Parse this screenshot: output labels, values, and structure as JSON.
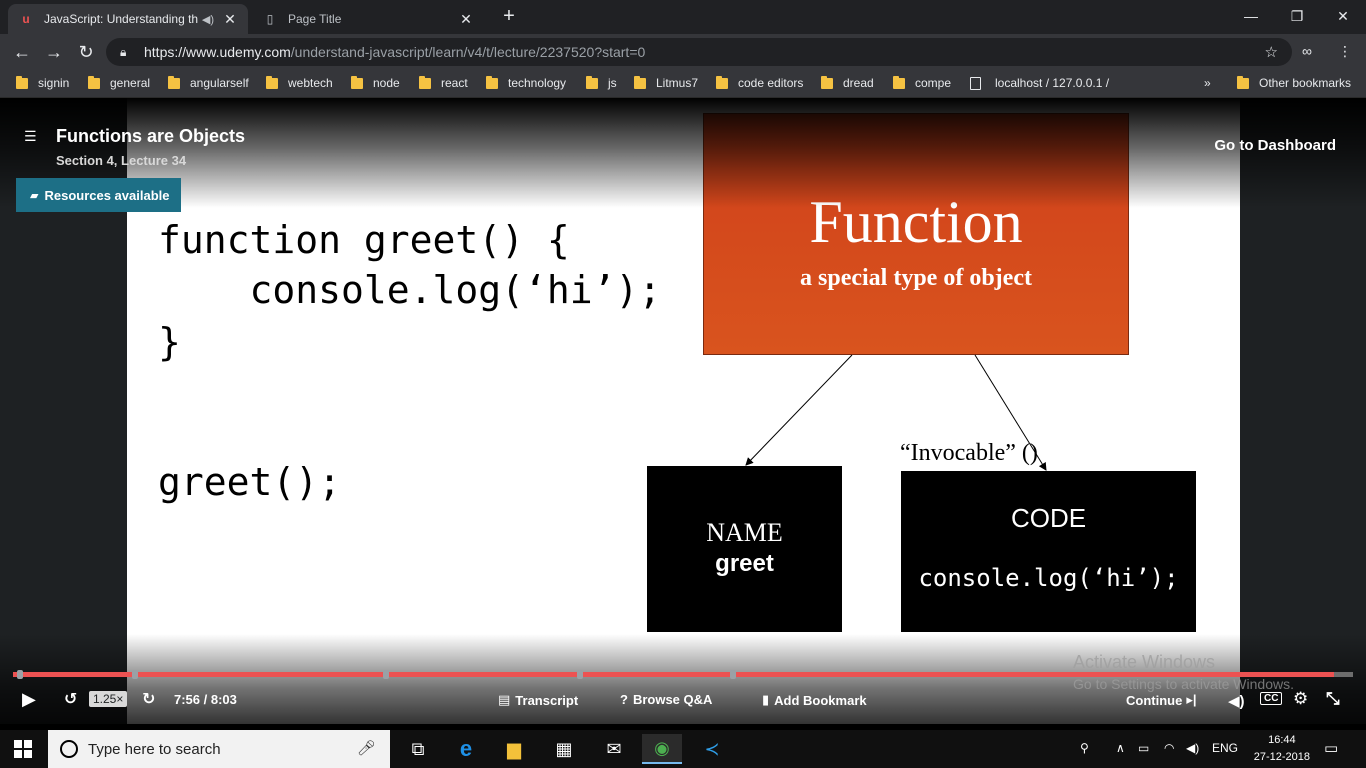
{
  "browser": {
    "tabs": [
      {
        "title": "JavaScript: Understanding th",
        "active": true
      },
      {
        "title": "Page Title",
        "active": false
      }
    ],
    "url_host": "https://www.udemy.com",
    "url_path": "/understand-javascript/learn/v4/t/lecture/2237520?start=0",
    "bookmarks": [
      "signin",
      "general",
      "angularself",
      "webtech",
      "node",
      "react",
      "technology",
      "js",
      "Litmus7",
      "code editors",
      "dread",
      "compe",
      "localhost / 127.0.0.1 /"
    ],
    "overflow": "»",
    "other_bookmarks": "Other bookmarks"
  },
  "lecture": {
    "title": "Functions are Objects",
    "subtitle": "Section 4, Lecture 34",
    "resources_label": "Resources available",
    "dashboard_label": "Go to Dashboard"
  },
  "slide": {
    "code_lines": [
      "function greet() {",
      "    console.log(‘hi’);",
      "}"
    ],
    "call_line": "greet();",
    "function_heading": "Function",
    "function_sub": "a special type of object",
    "name_label": "NAME",
    "name_value": "greet",
    "code_label": "CODE",
    "code_value": "console.log(‘hi’);",
    "invocable_label": "“Invocable” ()"
  },
  "watermark": {
    "line1": "Activate Windows",
    "line2": "Go to Settings to activate Windows."
  },
  "player": {
    "rate": "1.25×",
    "time": "7:56 / 8:03",
    "progress_fraction": 0.986,
    "transcript": "Transcript",
    "browse_qa": "Browse Q&A",
    "add_bookmark": "Add Bookmark",
    "continue_label": "Continue",
    "cc_label": "CC",
    "colors": {
      "progress": "#ec5252",
      "resources": "#1d6f86",
      "function_box": "#d9541e"
    }
  },
  "taskbar": {
    "search_placeholder": "Type here to search",
    "language": "ENG",
    "time": "16:44",
    "date": "27-12-2018"
  }
}
